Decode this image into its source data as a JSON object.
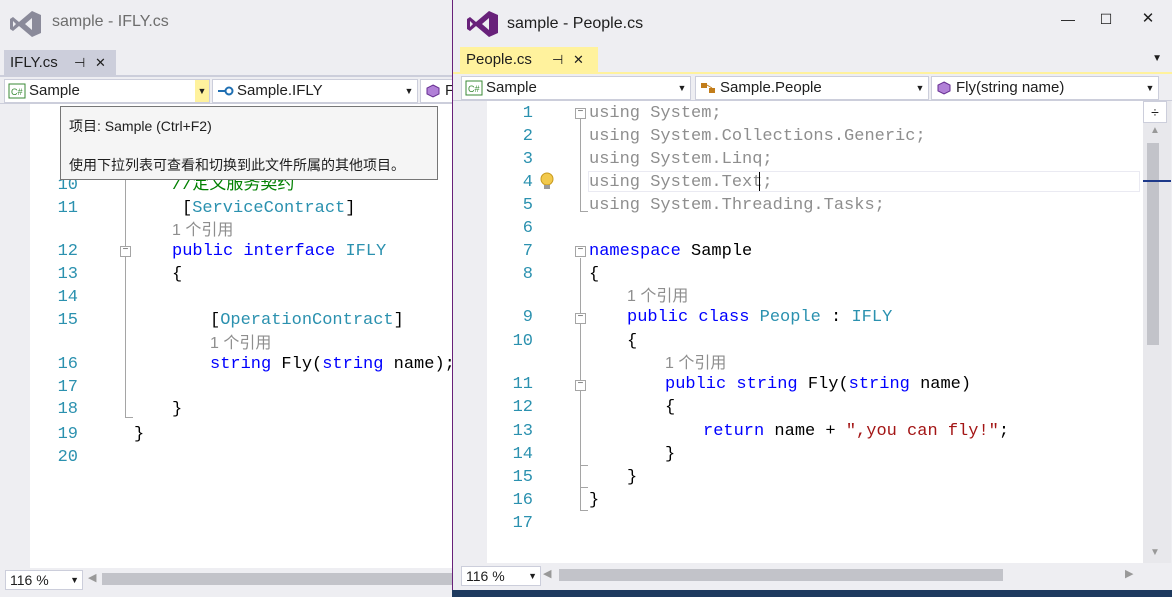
{
  "left_window": {
    "title": "sample - IFLY.cs",
    "tab": {
      "label": "IFLY.cs",
      "pin": "⊣",
      "close": "✕"
    },
    "nav": {
      "project": "Sample",
      "type": "Sample.IFLY",
      "member": "F"
    },
    "tooltip": {
      "line1": "项目: Sample (Ctrl+F2)",
      "line2": "使用下拉列表可查看和切换到此文件所属的其他项目。"
    },
    "lines": [
      {
        "n": "10",
        "parts": [
          [
            "cm",
            "//定义服务契约"
          ]
        ]
      },
      {
        "n": "11",
        "parts": [
          [
            "",
            "["
          ],
          [
            "ty",
            "ServiceContract"
          ],
          [
            "",
            "]"
          ]
        ]
      },
      {
        "n": "12",
        "parts": [
          [
            "kw",
            "public"
          ],
          [
            "",
            " "
          ],
          [
            "kw",
            "interface"
          ],
          [
            "",
            " "
          ],
          [
            "ty",
            "IFLY"
          ]
        ]
      },
      {
        "n": "13",
        "parts": [
          [
            "",
            "{"
          ]
        ]
      },
      {
        "n": "14",
        "parts": []
      },
      {
        "n": "15",
        "parts": [
          [
            "",
            "["
          ],
          [
            "ty",
            "OperationContract"
          ],
          [
            "",
            "]"
          ]
        ]
      },
      {
        "n": "16",
        "parts": [
          [
            "kw",
            "string"
          ],
          [
            "",
            " Fly("
          ],
          [
            "kw",
            "string"
          ],
          [
            "",
            " name);"
          ]
        ]
      },
      {
        "n": "17",
        "parts": []
      },
      {
        "n": "18",
        "parts": [
          [
            "",
            "}"
          ]
        ]
      },
      {
        "n": "19",
        "parts": [
          [
            "",
            "}"
          ]
        ]
      },
      {
        "n": "20",
        "parts": []
      }
    ],
    "refs": [
      "1 个引用",
      "1 个引用"
    ],
    "zoom": "116 %"
  },
  "right_window": {
    "title": "sample - People.cs",
    "tab": {
      "label": "People.cs",
      "pin": "⊣",
      "close": "✕"
    },
    "nav": {
      "project": "Sample",
      "type": "Sample.People",
      "member": "Fly(string name)"
    },
    "lines": [
      {
        "n": "1",
        "parts": [
          [
            "gr",
            "using System;"
          ]
        ]
      },
      {
        "n": "2",
        "parts": [
          [
            "gr",
            "using System.Collections.Generic;"
          ]
        ]
      },
      {
        "n": "3",
        "parts": [
          [
            "gr",
            "using System.Linq;"
          ]
        ]
      },
      {
        "n": "4",
        "parts": [
          [
            "gr",
            "using System.Text;"
          ]
        ]
      },
      {
        "n": "5",
        "parts": [
          [
            "gr",
            "using System.Threading.Tasks;"
          ]
        ]
      },
      {
        "n": "6",
        "parts": []
      },
      {
        "n": "7",
        "parts": [
          [
            "kw",
            "namespace"
          ],
          [
            "",
            " Sample"
          ]
        ]
      },
      {
        "n": "8",
        "parts": [
          [
            "",
            "{"
          ]
        ]
      },
      {
        "n": "9",
        "parts": [
          [
            "kw",
            "public"
          ],
          [
            "",
            " "
          ],
          [
            "kw",
            "class"
          ],
          [
            "",
            " "
          ],
          [
            "ty",
            "People"
          ],
          [
            "",
            " : "
          ],
          [
            "ty",
            "IFLY"
          ]
        ]
      },
      {
        "n": "10",
        "parts": [
          [
            "",
            "{"
          ]
        ]
      },
      {
        "n": "11",
        "parts": [
          [
            "kw",
            "public"
          ],
          [
            "",
            " "
          ],
          [
            "kw",
            "string"
          ],
          [
            "",
            " Fly("
          ],
          [
            "kw",
            "string"
          ],
          [
            "",
            " name)"
          ]
        ]
      },
      {
        "n": "12",
        "parts": [
          [
            "",
            "{"
          ]
        ]
      },
      {
        "n": "13",
        "parts": [
          [
            "kw",
            "return"
          ],
          [
            "",
            " name + "
          ],
          [
            "st",
            "\",you can fly!\""
          ],
          [
            "",
            ";"
          ]
        ]
      },
      {
        "n": "14",
        "parts": [
          [
            "",
            "}"
          ]
        ]
      },
      {
        "n": "15",
        "parts": [
          [
            "",
            "}"
          ]
        ]
      },
      {
        "n": "16",
        "parts": [
          [
            "",
            "}"
          ]
        ]
      },
      {
        "n": "17",
        "parts": []
      }
    ],
    "refs": [
      "1 个引用",
      "1 个引用"
    ],
    "zoom": "116 %"
  },
  "colors": {
    "keyword": "#0000ff",
    "type": "#2b91af",
    "string": "#a31515",
    "comment": "#008000",
    "active_tab": "#fff29d",
    "vs_purple": "#68217a"
  },
  "icons": [
    "vs-logo-icon",
    "csharp-project-icon",
    "interface-icon",
    "class-icon",
    "method-icon",
    "lightbulb-icon",
    "pin-icon",
    "close-icon",
    "minimize-icon",
    "maximize-icon",
    "dropdown-arrow-icon",
    "split-icon"
  ]
}
